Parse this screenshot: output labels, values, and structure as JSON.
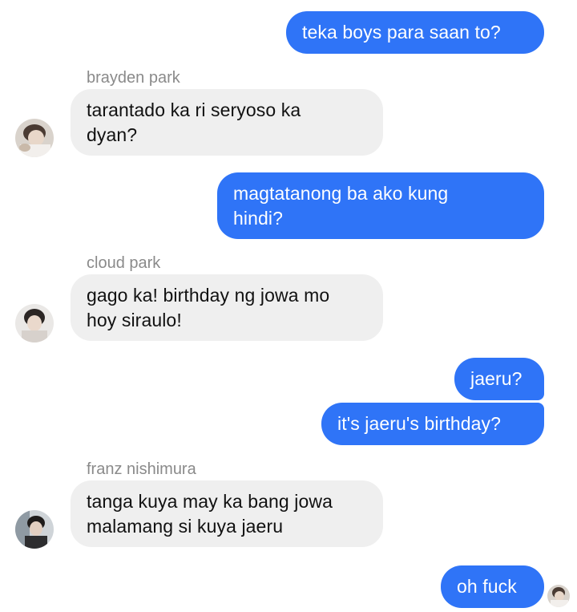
{
  "conversation": {
    "messages": [
      {
        "kind": "outgoing",
        "text": "teka boys para saan to?"
      },
      {
        "kind": "incoming",
        "sender": "brayden park",
        "text": "tarantado ka ri seryoso ka\ndyan?"
      },
      {
        "kind": "outgoing",
        "text": "magtatanong ba ako kung\nhindi?"
      },
      {
        "kind": "incoming",
        "sender": "cloud park",
        "text": "gago ka! birthday ng jowa mo\nhoy siraulo!"
      },
      {
        "kind": "outgoing",
        "text": "jaeru?"
      },
      {
        "kind": "outgoing",
        "text": "it's jaeru's birthday?"
      },
      {
        "kind": "incoming",
        "sender": "franz nishimura",
        "text": "tanga kuya may ka bang jowa\nmalamang si kuya jaeru"
      },
      {
        "kind": "outgoing",
        "text": "oh fuck"
      }
    ]
  },
  "colors": {
    "outgoing_bubble": "#2f74f7",
    "incoming_bubble": "#efefef",
    "sender_name": "#8a8a8a"
  }
}
